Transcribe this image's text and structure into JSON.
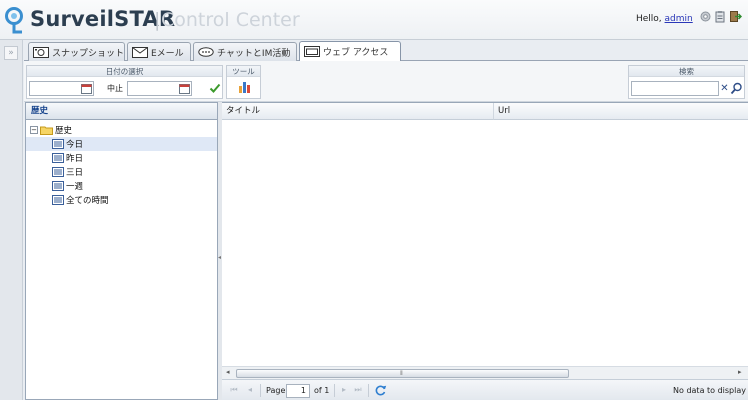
{
  "header": {
    "brand": "SurveilSTAR",
    "separator": "|",
    "subtitle": "Control Center",
    "greeting": "Hello, ",
    "username": "admin",
    "icons": [
      "gear-icon",
      "clipboard-icon",
      "logout-icon"
    ]
  },
  "tabs": [
    {
      "label": "スナップショット",
      "icon": "camera-icon",
      "active": false
    },
    {
      "label": "Eメール",
      "icon": "envelope-icon",
      "active": false
    },
    {
      "label": "チャットとIM活動",
      "icon": "chat-icon",
      "active": false
    },
    {
      "label": "ウェブ アクセス",
      "icon": "browser-window-icon",
      "active": true
    }
  ],
  "toolbar": {
    "date_group_title": "日付の選択",
    "start_date": "",
    "stop_label": "中止",
    "end_date": "",
    "tools_group_title": "ツール",
    "search_group_title": "検索",
    "search_value": ""
  },
  "tree": {
    "header": "歴史",
    "root": "歴史",
    "items": [
      {
        "label": "今日",
        "selected": true
      },
      {
        "label": "昨日",
        "selected": false
      },
      {
        "label": "三日",
        "selected": false
      },
      {
        "label": "一週",
        "selected": false
      },
      {
        "label": "全ての時間",
        "selected": false
      }
    ]
  },
  "grid": {
    "columns": [
      "タイトル",
      "Url"
    ],
    "rows": []
  },
  "pager": {
    "page_label": "Page",
    "page_value": "1",
    "of_label": "of 1",
    "status": "No data to display"
  },
  "colors": {
    "header_text": "#2c3e50",
    "link": "#2a37b8",
    "accent_blue": "#15428b",
    "selection": "#dfe8f6"
  }
}
